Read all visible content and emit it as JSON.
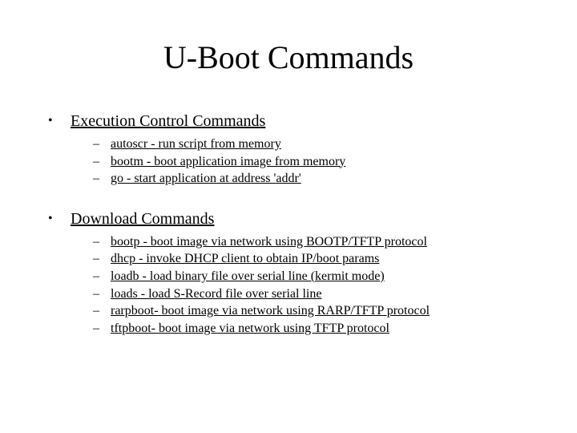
{
  "title": "U-Boot Commands",
  "sections": [
    {
      "heading": "Execution Control Commands",
      "items": [
        "autoscr - run script from memory",
        "bootm - boot application image from memory",
        "go - start application at address 'addr'"
      ]
    },
    {
      "heading": "Download Commands",
      "items": [
        "bootp - boot image via network using BOOTP/TFTP protocol",
        "dhcp - invoke DHCP client to obtain IP/boot params",
        "loadb - load binary file over serial line (kermit mode)",
        "loads - load S-Record file over serial line",
        "rarpboot- boot image via network using RARP/TFTP protocol",
        "tftpboot- boot image via network using TFTP protocol"
      ]
    }
  ],
  "glyphs": {
    "bullet": "•",
    "dash": "–"
  }
}
